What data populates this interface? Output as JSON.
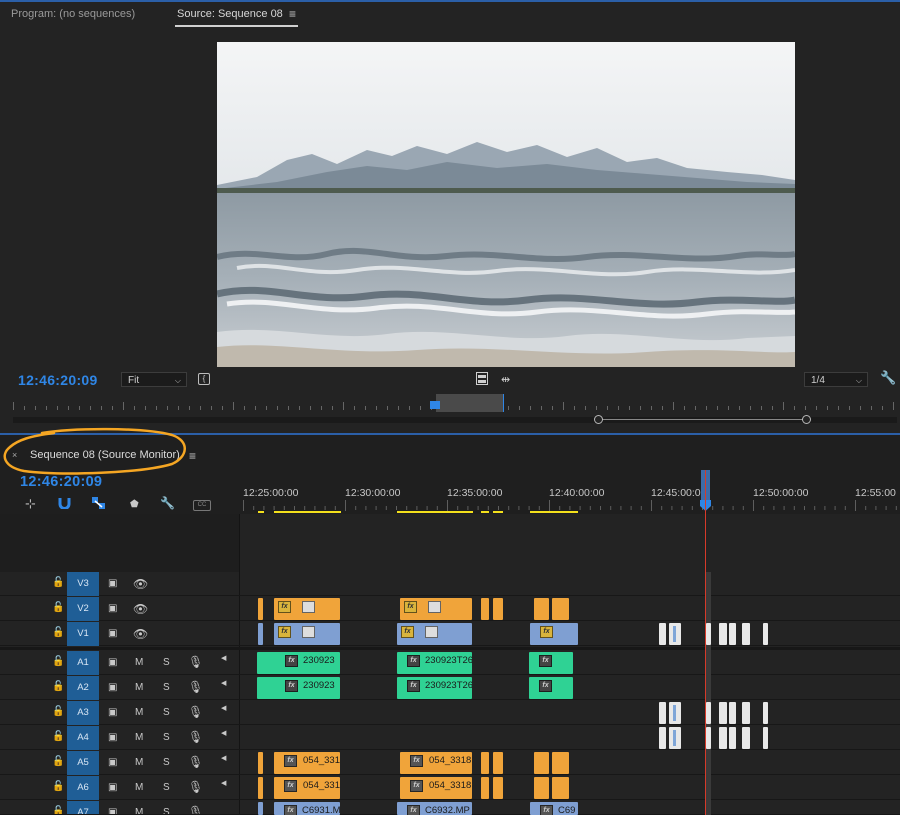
{
  "monitor": {
    "tabs": [
      {
        "label": "Program: (no sequences)"
      },
      {
        "label": "Source: Sequence 08"
      }
    ],
    "menu_icon": "hamburger-menu-icon",
    "timecode": "12:46:20:09",
    "zoom_select": "Fit",
    "resolution_select": "1/4"
  },
  "timeline": {
    "sequence_tab": "Sequence 08 (Source Monitor)",
    "close_glyph": "×",
    "timecode": "12:46:20:09",
    "ruler_labels": [
      "12:25:00:00",
      "12:30:00:00",
      "12:35:00:00",
      "12:40:00:00",
      "12:45:00:00",
      "12:50:00:00",
      "12:55:00"
    ],
    "video_tracks": [
      "V3",
      "V2",
      "V1"
    ],
    "audio_tracks": [
      "A1",
      "A2",
      "A3",
      "A4",
      "A5",
      "A6",
      "A7"
    ],
    "mute_label": "M",
    "solo_label": "S",
    "clip_labels": {
      "a1_1": "230923",
      "a1_2": "230923T26",
      "a2_1": "230923",
      "a2_2": "230923T26",
      "a5_1": "054_331",
      "a5_2": "054_3318",
      "a6_1": "054_331",
      "a6_2": "054_3318",
      "a7_1": "C6931.M",
      "a7_2": "C6932.MP",
      "a7_3": "C69"
    }
  },
  "colors": {
    "accent_blue": "#2f86e6",
    "annotation_orange": "#f5a623",
    "clip_orange": "#f0a43a",
    "clip_blue": "#7f9fd2",
    "clip_green": "#2fd294",
    "playhead_red": "#d63a2a"
  }
}
